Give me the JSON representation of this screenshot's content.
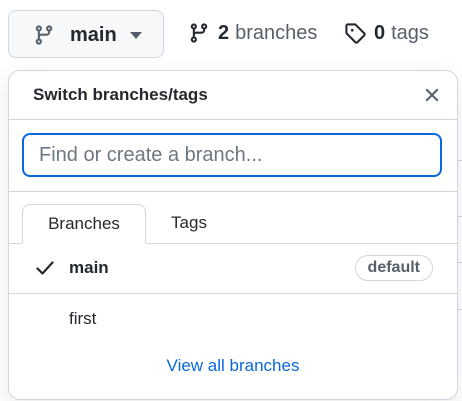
{
  "toolbar": {
    "current_branch": "main",
    "branches_count": "2",
    "branches_label": "branches",
    "tags_count": "0",
    "tags_label": "tags"
  },
  "popup": {
    "title": "Switch branches/tags",
    "search_placeholder": "Find or create a branch...",
    "search_value": "",
    "tabs": [
      {
        "label": "Branches",
        "active": true
      },
      {
        "label": "Tags",
        "active": false
      }
    ],
    "items": [
      {
        "name": "main",
        "selected": true,
        "badge": "default"
      },
      {
        "name": "first",
        "selected": false
      }
    ],
    "view_all": "View all branches"
  },
  "colors": {
    "accent": "#0969da",
    "border": "#d0d7de",
    "button_bg": "#f6f8fa",
    "muted_text": "#57606a"
  },
  "icons": {
    "branch": "git-branch-icon",
    "caret": "triangle-down-icon",
    "tag": "tag-icon",
    "close": "x-icon",
    "check": "check-icon"
  }
}
